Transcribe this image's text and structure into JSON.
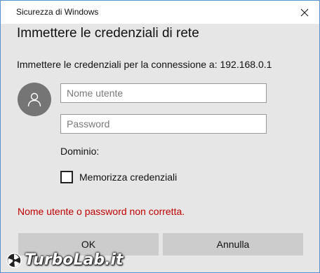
{
  "window": {
    "title": "Sicurezza di Windows"
  },
  "dialog": {
    "heading": "Immettere le credenziali di rete",
    "subtext": "Immettere le credenziali per la connessione a: 192.168.0.1",
    "username_placeholder": "Nome utente",
    "username_value": "",
    "password_placeholder": "Password",
    "password_value": "",
    "domain_label": "Dominio:",
    "remember_label": "Memorizza credenziali",
    "remember_checked": false,
    "error_message": "Nome utente o password non corretta.",
    "ok_label": "OK",
    "cancel_label": "Annulla"
  },
  "watermark": {
    "text": "TurboLab.it"
  },
  "colors": {
    "error": "#c00000",
    "background": "#e6e6e6",
    "button": "#cccccc",
    "avatar": "#757575",
    "border_accent": "#5a93cc"
  },
  "icons": {
    "close": "close-icon",
    "avatar": "user-avatar-icon"
  }
}
